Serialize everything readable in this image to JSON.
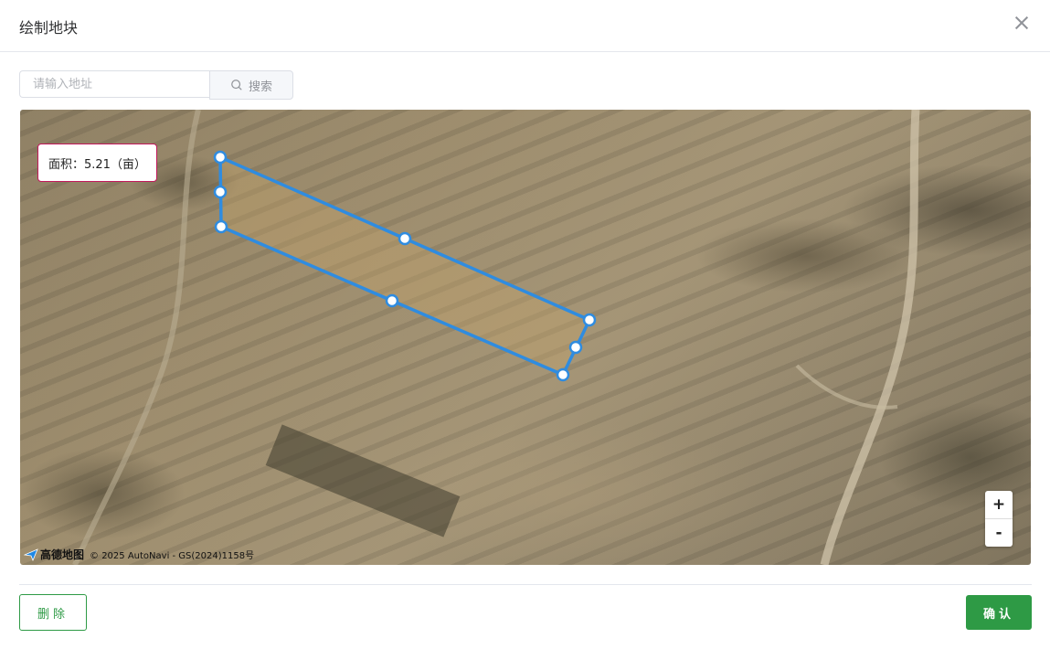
{
  "dialog": {
    "title": "绘制地块",
    "close_icon": "close-icon"
  },
  "search": {
    "placeholder": "请输入地址",
    "value": "",
    "button_label": "搜索",
    "button_icon": "search-icon"
  },
  "map": {
    "area_label": "面积：5.21（亩）",
    "zoom_in": "+",
    "zoom_out": "-",
    "attribution": {
      "logo_text": "高德地图",
      "text": "© 2025 AutoNavi - GS(2024)1158号"
    },
    "polygon_color": "#2f8ce0"
  },
  "footer": {
    "delete_label": "删除",
    "confirm_label": "确认",
    "accent_color": "#2e9a45"
  }
}
